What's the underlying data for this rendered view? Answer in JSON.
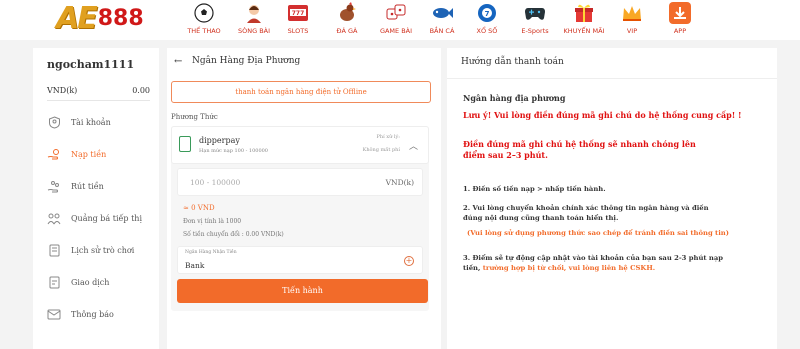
{
  "brand": {
    "logo_ae": "AE",
    "logo_num": "888"
  },
  "nav": [
    {
      "label": "THỂ THAO",
      "icon": "soccer-ball-icon"
    },
    {
      "label": "SÒNG BÀI",
      "icon": "dealer-icon"
    },
    {
      "label": "SLOTS",
      "icon": "slot-machine-icon"
    },
    {
      "label": "ĐÁ GÀ",
      "icon": "rooster-icon"
    },
    {
      "label": "GAME BÀI",
      "icon": "dice-icon"
    },
    {
      "label": "BẮN CÁ",
      "icon": "fish-icon"
    },
    {
      "label": "XỔ SỐ",
      "icon": "lottery-ball-icon"
    },
    {
      "label": "E-Sports",
      "icon": "gamepad-icon"
    },
    {
      "label": "KHUYẾN MÃI",
      "icon": "gift-icon"
    },
    {
      "label": "VIP",
      "icon": "crown-icon"
    },
    {
      "label": "APP",
      "icon": "download-icon"
    }
  ],
  "sidebar": {
    "username": "ngocham1111",
    "currency": "VND(k)",
    "balance": "0.00",
    "items": [
      {
        "label": "Tài khoản",
        "icon": "user-icon"
      },
      {
        "label": "Nạp tiền",
        "icon": "deposit-icon"
      },
      {
        "label": "Rút tiền",
        "icon": "withdraw-icon"
      },
      {
        "label": "Quảng bá tiếp thị",
        "icon": "promote-icon"
      },
      {
        "label": "Lịch sử trò chơi",
        "icon": "history-icon"
      },
      {
        "label": "Giao dịch",
        "icon": "transaction-icon"
      },
      {
        "label": "Thông báo",
        "icon": "mail-icon"
      }
    ]
  },
  "main": {
    "back_icon": "←",
    "title": "Ngân Hàng Địa Phương",
    "offline_button": "thanh toán ngân hàng điện tử Offline",
    "payment_method_label": "Phương Thức",
    "payment": {
      "name": "dipperpay",
      "limit": "Hạn mức nạp 100 - 100000",
      "fee_label": "Phí xử lý:",
      "fee_value": "Không mất phí"
    },
    "amount": {
      "placeholder": "100 - 100000",
      "unit": "VND(k)"
    },
    "vnd_equivalent": "≈ 0 VND",
    "unit_info": "Đơn vị tính là 1000",
    "conversion_info": "Số tiền chuyển đổi : 0.00 VND(k)",
    "bank": {
      "label": "Ngân Hàng Nhận Tiền",
      "value": "Bank"
    },
    "submit_button": "Tiến hành"
  },
  "guide": {
    "title": "Hướng dẫn thanh toán",
    "heading": "Ngân hàng địa phương",
    "warning1": "Lưu ý! Vui lòng điền đúng mã ghi chú do hệ thống cung cấp! !",
    "warning2": "Điền đúng mã ghi chú hệ thống sẽ nhanh chóng lên điểm sau 2–3 phút.",
    "step1": "1. Điền số tiền nạp > nhấp tiến hành.",
    "step2": "2. Vui lòng chuyển khoản chính xác thông tin ngân hàng và điền đúng nội dung cũng thanh toán hiển thị.",
    "step2_note": "(Vui lòng sử dụng phương thức sao chép để tránh điền sai thông tin)",
    "step3_prefix": "3. Điểm sẽ tự động cập nhật vào tài khoản của bạn sau 2-3 phút nạp tiền,",
    "step3_suffix": "trường hợp bị từ chối, vui lòng liên hệ CSKH."
  },
  "colors": {
    "accent": "#f26b2a",
    "warning": "#e01010",
    "brand_red": "#d01818"
  }
}
